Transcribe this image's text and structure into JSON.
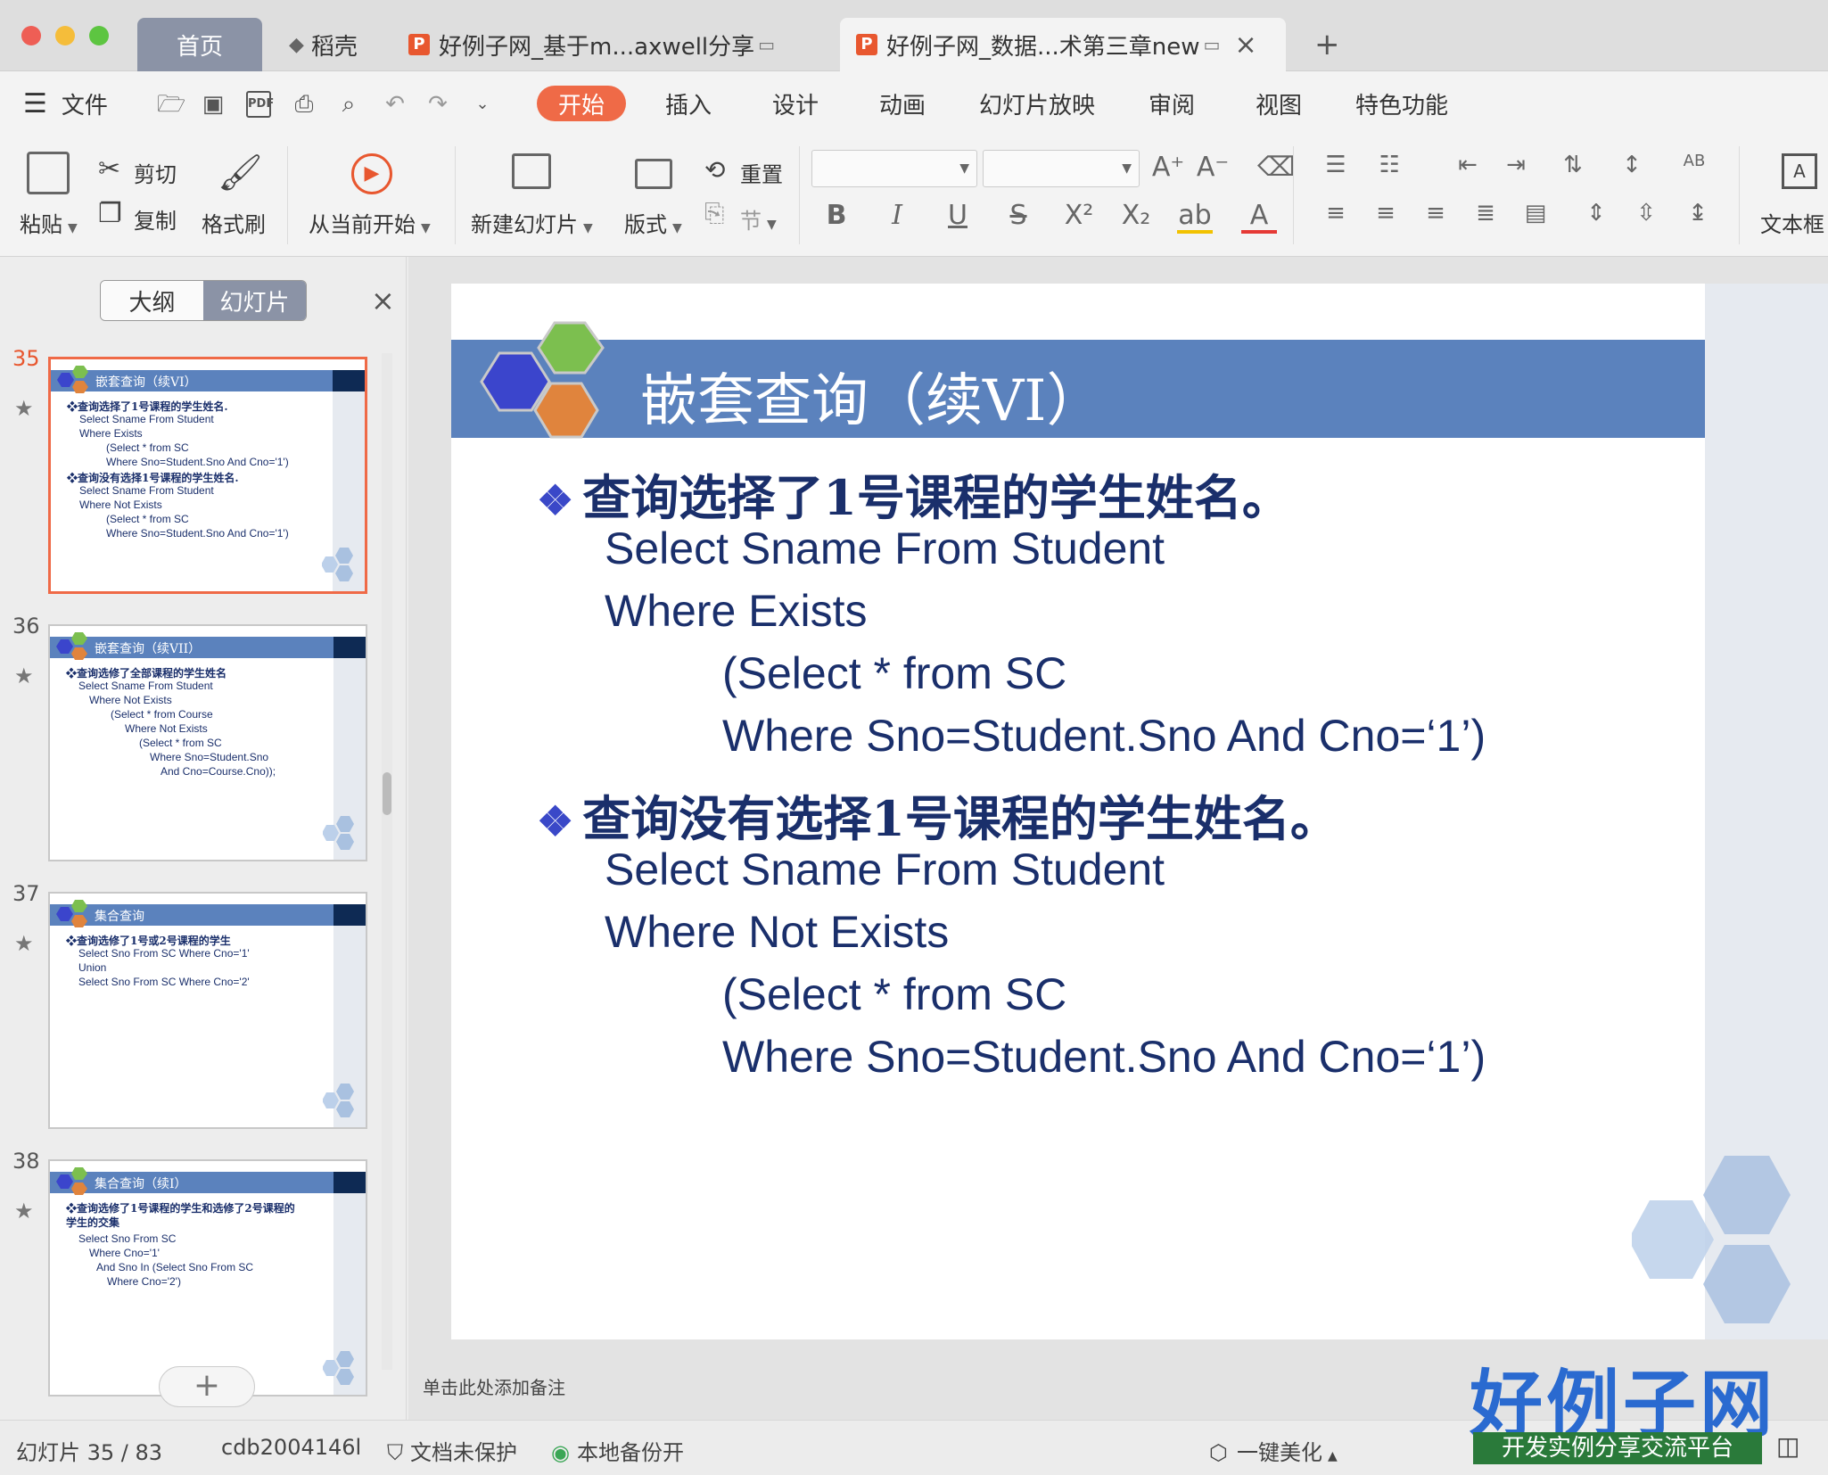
{
  "tabs": {
    "home": "首页",
    "daoke": "稻壳",
    "doc1": "好例子网_基于m...axwell分享",
    "doc2": "好例子网_数据...术第三章new",
    "add": "+"
  },
  "menu": {
    "file": "文件",
    "items": [
      "开始",
      "插入",
      "设计",
      "动画",
      "幻灯片放映",
      "审阅",
      "视图",
      "特色功能"
    ],
    "active": "开始"
  },
  "ribbon": {
    "paste": "粘贴",
    "cut": "剪切",
    "copy": "复制",
    "format_painter": "格式刷",
    "from_current": "从当前开始",
    "new_slide": "新建幻灯片",
    "layout": "版式",
    "reset": "重置",
    "section": "节",
    "textbox": "文本框"
  },
  "left_pane": {
    "tab_outline": "大纲",
    "tab_slides": "幻灯片",
    "close": "×",
    "add_slide": "+",
    "thumbs": [
      {
        "num": "35",
        "title": "嵌套查询（续VI）",
        "lines": [
          {
            "t": "❖查询选择了1号课程的学生姓名.",
            "h": true
          },
          {
            "t": "Select Sname From Student"
          },
          {
            "t": "Where Exists"
          },
          {
            "t": "(Select * from SC"
          },
          {
            "t": "Where Sno=Student.Sno And Cno='1')"
          },
          {
            "t": "❖查询没有选择1号课程的学生姓名.",
            "h": true
          },
          {
            "t": "Select Sname From Student"
          },
          {
            "t": "Where Not Exists"
          },
          {
            "t": "(Select * from SC"
          },
          {
            "t": "Where Sno=Student.Sno And Cno='1')"
          }
        ]
      },
      {
        "num": "36",
        "title": "嵌套查询（续VII）",
        "lines": [
          {
            "t": "❖查询选修了全部课程的学生姓名",
            "h": true
          },
          {
            "t": "Select Sname From Student"
          },
          {
            "t": "Where Not Exists"
          },
          {
            "t": "(Select * from Course"
          },
          {
            "t": "Where Not Exists"
          },
          {
            "t": "(Select * from SC"
          },
          {
            "t": "Where Sno=Student.Sno"
          },
          {
            "t": "And Cno=Course.Cno));"
          }
        ]
      },
      {
        "num": "37",
        "title": "集合查询",
        "lines": [
          {
            "t": "❖查询选修了1号或2号课程的学生",
            "h": true
          },
          {
            "t": "Select Sno From SC Where Cno='1'"
          },
          {
            "t": "Union"
          },
          {
            "t": "Select Sno From SC Where Cno='2'"
          }
        ]
      },
      {
        "num": "38",
        "title": "集合查询（续I）",
        "lines": [
          {
            "t": "❖查询选修了1号课程的学生和选修了2号课程的",
            "h": true
          },
          {
            "t": "学生的交集",
            "h": true
          },
          {
            "t": "Select Sno From SC"
          },
          {
            "t": "Where Cno='1'"
          },
          {
            "t": "And Sno In (Select Sno From SC"
          },
          {
            "t": "Where Cno='2')"
          }
        ]
      }
    ]
  },
  "slide": {
    "title": "嵌套查询（续VI）",
    "heading1": "查询选择了1号课程的学生姓名。",
    "code1": [
      "Select Sname From Student",
      "Where Exists",
      "(Select * from SC",
      "Where Sno=Student.Sno And Cno=‘1’)"
    ],
    "heading2": "查询没有选择1号课程的学生姓名。",
    "code2": [
      "Select Sname From Student",
      "Where Not Exists",
      "(Select * from SC",
      "Where Sno=Student.Sno And Cno=‘1’)"
    ],
    "bullet": "❖"
  },
  "notes_placeholder": "单击此处添加备注",
  "status": {
    "slide_count": "幻灯片 35 / 83",
    "theme": "cdb2004146l",
    "protect": "文档未保护",
    "backup": "本地备份开",
    "beautify": "一键美化"
  },
  "brand": {
    "name": "好例子网",
    "tagline": "开发实例分享交流平台"
  },
  "colors": {
    "accent": "#ef6a47",
    "slide_bar": "#5b82bd",
    "slide_text": "#1a2f6b"
  }
}
